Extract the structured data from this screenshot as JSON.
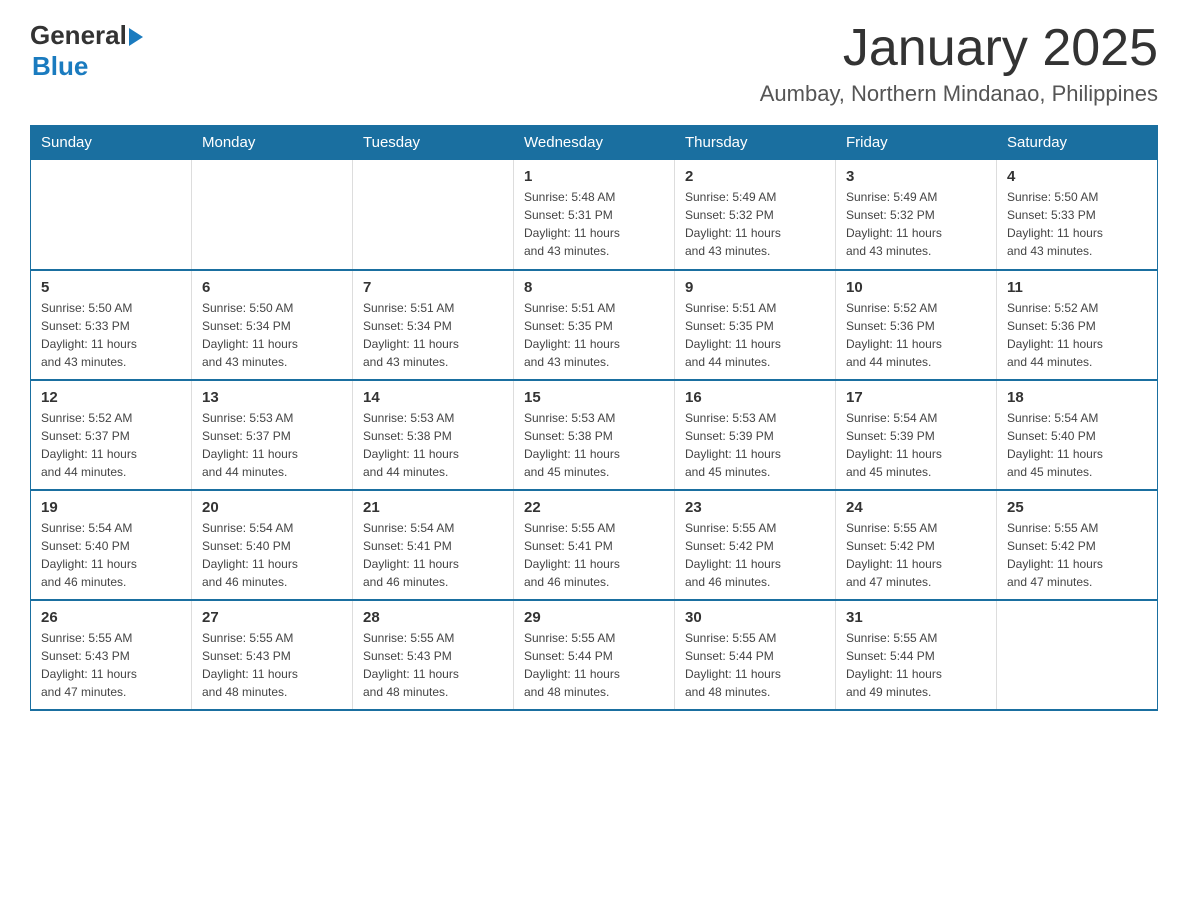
{
  "logo": {
    "general": "General",
    "blue": "Blue"
  },
  "title": "January 2025",
  "subtitle": "Aumbay, Northern Mindanao, Philippines",
  "days_of_week": [
    "Sunday",
    "Monday",
    "Tuesday",
    "Wednesday",
    "Thursday",
    "Friday",
    "Saturday"
  ],
  "weeks": [
    [
      {
        "day": "",
        "info": ""
      },
      {
        "day": "",
        "info": ""
      },
      {
        "day": "",
        "info": ""
      },
      {
        "day": "1",
        "info": "Sunrise: 5:48 AM\nSunset: 5:31 PM\nDaylight: 11 hours\nand 43 minutes."
      },
      {
        "day": "2",
        "info": "Sunrise: 5:49 AM\nSunset: 5:32 PM\nDaylight: 11 hours\nand 43 minutes."
      },
      {
        "day": "3",
        "info": "Sunrise: 5:49 AM\nSunset: 5:32 PM\nDaylight: 11 hours\nand 43 minutes."
      },
      {
        "day": "4",
        "info": "Sunrise: 5:50 AM\nSunset: 5:33 PM\nDaylight: 11 hours\nand 43 minutes."
      }
    ],
    [
      {
        "day": "5",
        "info": "Sunrise: 5:50 AM\nSunset: 5:33 PM\nDaylight: 11 hours\nand 43 minutes."
      },
      {
        "day": "6",
        "info": "Sunrise: 5:50 AM\nSunset: 5:34 PM\nDaylight: 11 hours\nand 43 minutes."
      },
      {
        "day": "7",
        "info": "Sunrise: 5:51 AM\nSunset: 5:34 PM\nDaylight: 11 hours\nand 43 minutes."
      },
      {
        "day": "8",
        "info": "Sunrise: 5:51 AM\nSunset: 5:35 PM\nDaylight: 11 hours\nand 43 minutes."
      },
      {
        "day": "9",
        "info": "Sunrise: 5:51 AM\nSunset: 5:35 PM\nDaylight: 11 hours\nand 44 minutes."
      },
      {
        "day": "10",
        "info": "Sunrise: 5:52 AM\nSunset: 5:36 PM\nDaylight: 11 hours\nand 44 minutes."
      },
      {
        "day": "11",
        "info": "Sunrise: 5:52 AM\nSunset: 5:36 PM\nDaylight: 11 hours\nand 44 minutes."
      }
    ],
    [
      {
        "day": "12",
        "info": "Sunrise: 5:52 AM\nSunset: 5:37 PM\nDaylight: 11 hours\nand 44 minutes."
      },
      {
        "day": "13",
        "info": "Sunrise: 5:53 AM\nSunset: 5:37 PM\nDaylight: 11 hours\nand 44 minutes."
      },
      {
        "day": "14",
        "info": "Sunrise: 5:53 AM\nSunset: 5:38 PM\nDaylight: 11 hours\nand 44 minutes."
      },
      {
        "day": "15",
        "info": "Sunrise: 5:53 AM\nSunset: 5:38 PM\nDaylight: 11 hours\nand 45 minutes."
      },
      {
        "day": "16",
        "info": "Sunrise: 5:53 AM\nSunset: 5:39 PM\nDaylight: 11 hours\nand 45 minutes."
      },
      {
        "day": "17",
        "info": "Sunrise: 5:54 AM\nSunset: 5:39 PM\nDaylight: 11 hours\nand 45 minutes."
      },
      {
        "day": "18",
        "info": "Sunrise: 5:54 AM\nSunset: 5:40 PM\nDaylight: 11 hours\nand 45 minutes."
      }
    ],
    [
      {
        "day": "19",
        "info": "Sunrise: 5:54 AM\nSunset: 5:40 PM\nDaylight: 11 hours\nand 46 minutes."
      },
      {
        "day": "20",
        "info": "Sunrise: 5:54 AM\nSunset: 5:40 PM\nDaylight: 11 hours\nand 46 minutes."
      },
      {
        "day": "21",
        "info": "Sunrise: 5:54 AM\nSunset: 5:41 PM\nDaylight: 11 hours\nand 46 minutes."
      },
      {
        "day": "22",
        "info": "Sunrise: 5:55 AM\nSunset: 5:41 PM\nDaylight: 11 hours\nand 46 minutes."
      },
      {
        "day": "23",
        "info": "Sunrise: 5:55 AM\nSunset: 5:42 PM\nDaylight: 11 hours\nand 46 minutes."
      },
      {
        "day": "24",
        "info": "Sunrise: 5:55 AM\nSunset: 5:42 PM\nDaylight: 11 hours\nand 47 minutes."
      },
      {
        "day": "25",
        "info": "Sunrise: 5:55 AM\nSunset: 5:42 PM\nDaylight: 11 hours\nand 47 minutes."
      }
    ],
    [
      {
        "day": "26",
        "info": "Sunrise: 5:55 AM\nSunset: 5:43 PM\nDaylight: 11 hours\nand 47 minutes."
      },
      {
        "day": "27",
        "info": "Sunrise: 5:55 AM\nSunset: 5:43 PM\nDaylight: 11 hours\nand 48 minutes."
      },
      {
        "day": "28",
        "info": "Sunrise: 5:55 AM\nSunset: 5:43 PM\nDaylight: 11 hours\nand 48 minutes."
      },
      {
        "day": "29",
        "info": "Sunrise: 5:55 AM\nSunset: 5:44 PM\nDaylight: 11 hours\nand 48 minutes."
      },
      {
        "day": "30",
        "info": "Sunrise: 5:55 AM\nSunset: 5:44 PM\nDaylight: 11 hours\nand 48 minutes."
      },
      {
        "day": "31",
        "info": "Sunrise: 5:55 AM\nSunset: 5:44 PM\nDaylight: 11 hours\nand 49 minutes."
      },
      {
        "day": "",
        "info": ""
      }
    ]
  ],
  "colors": {
    "header_bg": "#1a6fa0",
    "header_text": "#ffffff",
    "border": "#1a6fa0"
  }
}
